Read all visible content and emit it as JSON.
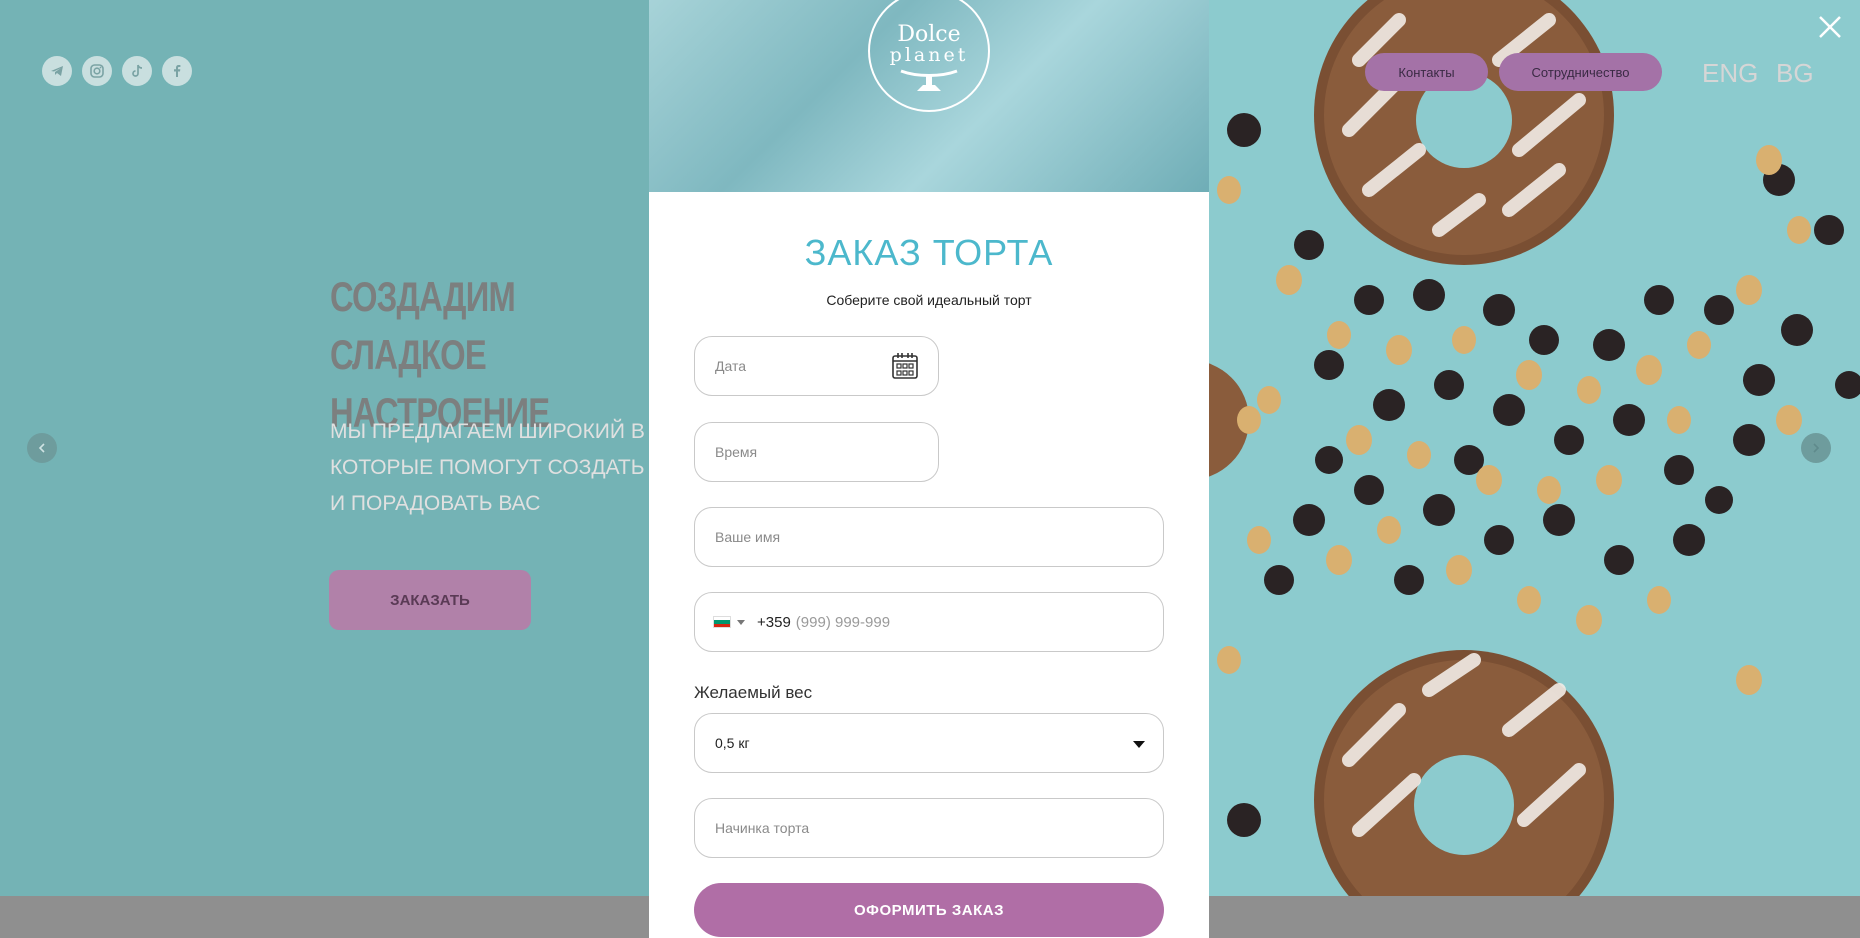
{
  "background": {
    "social_icons": [
      "telegram-icon",
      "instagram-icon",
      "tiktok-icon",
      "facebook-icon"
    ],
    "nav": {
      "contacts_label": "Контакты",
      "partnership_label": "Сотрудничество"
    },
    "languages": [
      "ENG",
      "BG"
    ],
    "hero": {
      "title_line1": "СОЗДАДИМ СЛАДКОЕ",
      "title_line2": "НАСТРОЕНИЕ",
      "sub_line1": "МЫ ПРЕДЛАГАЕМ ШИРОКИЙ В",
      "sub_line2": "КОТОРЫЕ ПОМОГУТ СОЗДАТЬ",
      "sub_line3": "И ПОРАДОВАТЬ ВАС",
      "order_button": "ЗАКАЗАТЬ"
    }
  },
  "modal": {
    "logo_line1": "Dolce",
    "logo_line2": "planet",
    "title": "ЗАКАЗ ТОРТА",
    "subtitle": "Соберите свой идеальный торт",
    "date_placeholder": "Дата",
    "time_placeholder": "Время",
    "name_placeholder": "Ваше имя",
    "phone_code": "+359",
    "phone_mask": "(999) 999-999",
    "weight_label": "Желаемый вес",
    "weight_value": "0,5 кг",
    "filling_placeholder": "Начинка торта",
    "submit_label": "ОФОРМИТЬ ЗАКАЗ"
  },
  "colors": {
    "accent_teal": "#4cb8cc",
    "button_purple": "#b06ea6",
    "overlay_teal": "#74b3b5"
  }
}
